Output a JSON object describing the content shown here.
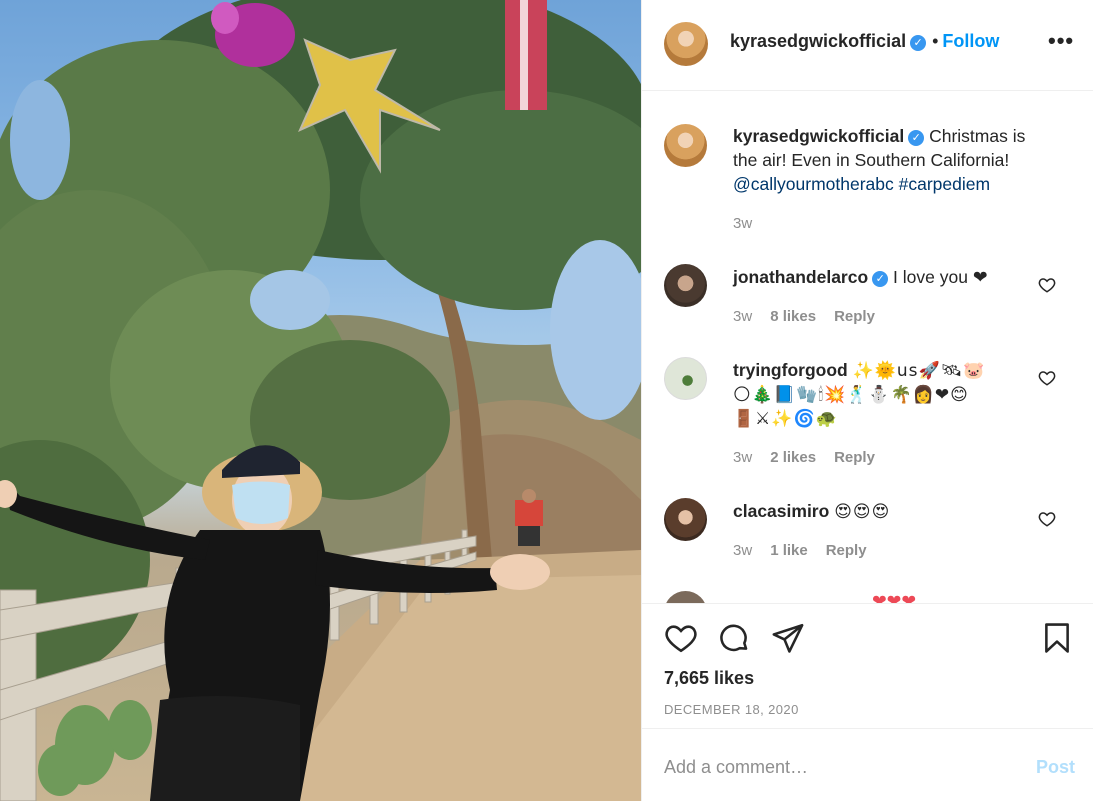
{
  "post": {
    "username": "kyrasedgwickofficial",
    "follow_label": "Follow",
    "header_separator": "•",
    "more_label": "•••",
    "caption": {
      "username": "kyrasedgwickofficial",
      "text": "Christmas is the air! Even in Southern California!",
      "mention": "@callyourmotherabc",
      "hashtag": "#carpediem",
      "time": "3w"
    },
    "likes": "7,665 likes",
    "date": "DECEMBER 18, 2020",
    "add_comment_placeholder": "Add a comment…",
    "post_label": "Post"
  },
  "comments": [
    {
      "username": "jonathandelarco",
      "verified": true,
      "text": "I love you ❤",
      "time": "3w",
      "likes": "8 likes",
      "reply": "Reply"
    },
    {
      "username": "tryingforgood",
      "verified": false,
      "line1": "✨🌞us🚀🛰🐷",
      "line2": "🌕🎄📘🧤🕯💥🕺⛄🌴👩❤😊",
      "line3": "🚪⚔✨🌀🐢",
      "time": "3w",
      "likes": "2 likes",
      "reply": "Reply"
    },
    {
      "username": "clacasimiro",
      "verified": false,
      "text": "😍😍😍",
      "time": "3w",
      "likes": "1 like",
      "reply": "Reply"
    },
    {
      "username": "",
      "verified": false,
      "text": "❤❤❤",
      "partial": true
    }
  ],
  "colors": {
    "accent": "#0095f6",
    "verified": "#3897f0",
    "heart": "#ed4956",
    "muted": "#8e8e8e",
    "link": "#00376b"
  },
  "icons": [
    "heart-icon",
    "comment-icon",
    "share-icon",
    "bookmark-icon",
    "more-options-icon",
    "verified-badge-icon"
  ]
}
